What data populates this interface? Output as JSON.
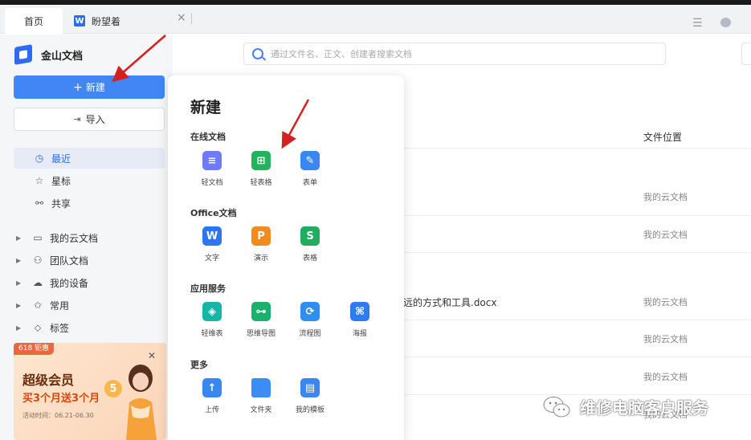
{
  "tabs": {
    "home": "首页",
    "doc_badge": "W",
    "doc_title": "盼望着",
    "close": "×"
  },
  "app": {
    "name": "金山文档"
  },
  "sidebar": {
    "new_label": "新建",
    "new_icon": "+",
    "import_label": "导入",
    "nav": [
      {
        "label": "最近",
        "icon": "clock-icon"
      },
      {
        "label": "星标",
        "icon": "star-icon"
      },
      {
        "label": "共享",
        "icon": "share-icon"
      }
    ],
    "tree": [
      {
        "label": "我的云文档",
        "icon": "folder-icon"
      },
      {
        "label": "团队文档",
        "icon": "team-icon"
      },
      {
        "label": "我的设备",
        "icon": "cloud-icon"
      },
      {
        "label": "常用",
        "icon": "pin-icon"
      },
      {
        "label": "标签",
        "icon": "tag-icon"
      }
    ]
  },
  "promo": {
    "tag": "618 钜惠",
    "title": "超级会员",
    "subtitle": "买3个月送3个月",
    "date": "活动时间：06.21-06.30",
    "coin": "5"
  },
  "search": {
    "placeholder": "通过文件名、正文、创建者搜索文档"
  },
  "file_list": {
    "column_location": "文件位置",
    "partial_name": "远的方式和工具.docx",
    "locations": [
      "我的云文档",
      "我的云文档",
      "我的云文档",
      "我的云文档",
      "我的云文档",
      "我的云文档"
    ]
  },
  "new_menu": {
    "title": "新建",
    "sections": [
      {
        "title": "在线文档",
        "items": [
          {
            "label": "轻文档",
            "glyph": "≡",
            "color": "#6f7cf5"
          },
          {
            "label": "轻表格",
            "glyph": "⊞",
            "color": "#22b35e"
          },
          {
            "label": "表单",
            "glyph": "✎",
            "color": "#3a86f2"
          }
        ]
      },
      {
        "title": "Office文档",
        "items": [
          {
            "label": "文字",
            "glyph": "W",
            "color": "#2f75f0"
          },
          {
            "label": "演示",
            "glyph": "P",
            "color": "#f08c1d"
          },
          {
            "label": "表格",
            "glyph": "S",
            "color": "#1fae5f"
          }
        ]
      },
      {
        "title": "应用服务",
        "items": [
          {
            "label": "轻维表",
            "glyph": "◈",
            "color": "#17b5a6"
          },
          {
            "label": "思维导图",
            "glyph": "⊶",
            "color": "#1ab06d"
          },
          {
            "label": "流程图",
            "glyph": "⟳",
            "color": "#2f8ef2"
          },
          {
            "label": "海报",
            "glyph": "⌘",
            "color": "#2f7cf0"
          }
        ]
      },
      {
        "title": "更多",
        "items": [
          {
            "label": "上传",
            "glyph": "↑",
            "color": "#3a86f2"
          },
          {
            "label": "文件夹",
            "glyph": "",
            "color": "#3b8df5"
          },
          {
            "label": "我的模板",
            "glyph": "▤",
            "color": "#3a86f2"
          }
        ]
      }
    ]
  },
  "watermark": {
    "text": "维修电脑客户服务"
  },
  "colors": {
    "accent": "#4285f4",
    "annotation_arrow": "#d42020"
  }
}
